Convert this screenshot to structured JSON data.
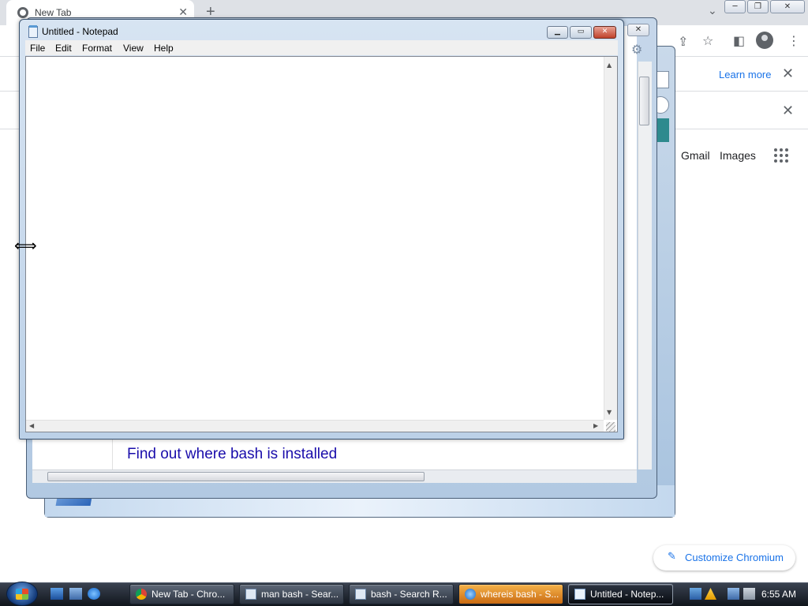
{
  "chrome": {
    "tab_title": "New Tab",
    "tab_close": "✕",
    "new_tab": "+",
    "tab_search": "⌄",
    "window_controls": {
      "minimize": "─",
      "restore": "❐",
      "close": "✕"
    },
    "toolbar": {
      "share": "⇪",
      "bookmark": "☆",
      "sidepanel": "◧",
      "menu": "⋮"
    },
    "infobar_learn_more": "Learn more",
    "close_glyph": "✕",
    "gmail": "Gmail",
    "images": "Images",
    "customize_label": "Customize Chromium",
    "customize_icon": "✎"
  },
  "search_window": {
    "result_title": "Find out where bash is installed",
    "close": "✕",
    "gear": "⚙",
    "scroll_glyph": "|||"
  },
  "notepad": {
    "title": "Untitled - Notepad",
    "controls": {
      "minimize": "▁",
      "maximize": "▭",
      "close": "✕"
    },
    "menu": [
      "File",
      "Edit",
      "Format",
      "View",
      "Help"
    ],
    "content": "",
    "scroll_up": "▲",
    "scroll_down": "▼",
    "scroll_left": "◀",
    "scroll_right": "▶"
  },
  "cursor": "⟺",
  "taskbar": {
    "items": [
      {
        "label": "New Tab - Chro...",
        "icon": "chrome-icon"
      },
      {
        "label": "man bash - Sear...",
        "icon": "search-doc-icon"
      },
      {
        "label": "bash - Search R...",
        "icon": "search-doc-icon"
      },
      {
        "label": "whereis bash - S...",
        "icon": "ie-icon"
      },
      {
        "label": "Untitled - Notep...",
        "icon": "notepad-icon"
      }
    ],
    "clock": "6:55 AM"
  }
}
